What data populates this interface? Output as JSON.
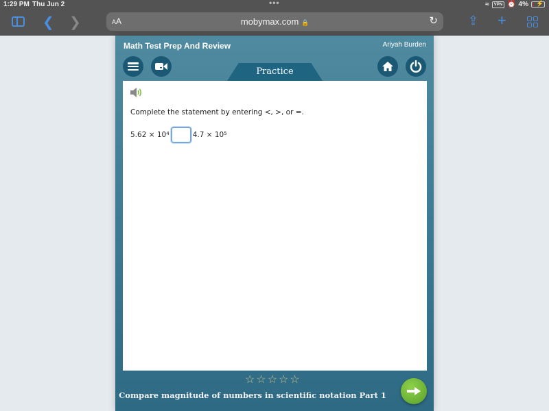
{
  "status_bar": {
    "time": "1:29 PM",
    "date": "Thu Jun 2",
    "vpn_label": "VPN",
    "battery": "4%"
  },
  "browser": {
    "text_size_label": "AA",
    "url": "mobymax.com",
    "icons": [
      "sidebar-icon",
      "back-icon",
      "forward-icon",
      "lock-icon",
      "reload-icon",
      "share-icon",
      "new-tab-icon",
      "tabs-overview-icon"
    ]
  },
  "app": {
    "title": "Math Test Prep And Review",
    "user_name": "Ariyah Burden",
    "mode_tab": "Practice",
    "buttons": [
      "menu-icon",
      "video-icon",
      "home-icon",
      "power-icon"
    ],
    "colors": {
      "header": "#4f8aa0",
      "button": "#1b5874",
      "next": "#6bb535"
    }
  },
  "question": {
    "prompt": "Complete the statement by entering <, >, or =.",
    "left_mantissa": "5.62 × 10",
    "left_exponent": "4",
    "answer_value": "",
    "right_mantissa": "4.7 × 10",
    "right_exponent": "5"
  },
  "footer": {
    "stars_total": 5,
    "stars_filled": 0,
    "skill_name": "Compare magnitude of numbers in scientific notation Part 1"
  }
}
